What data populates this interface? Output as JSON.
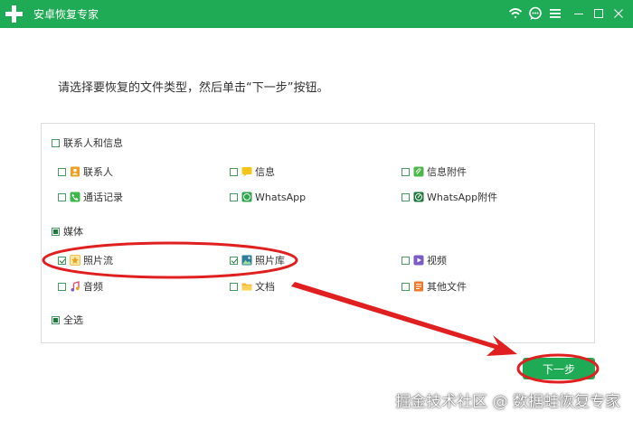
{
  "app": {
    "title": "安卓恢复专家"
  },
  "instruction": "请选择要恢复的文件类型，然后单击“下一步”按钮。",
  "groups": {
    "contacts": {
      "label": "联系人和信息",
      "state": "unchecked",
      "items": [
        {
          "label": "联系人",
          "checked": false,
          "icon": "contact-book-icon"
        },
        {
          "label": "信息",
          "checked": false,
          "icon": "message-icon"
        },
        {
          "label": "信息附件",
          "checked": false,
          "icon": "attachment-icon"
        },
        {
          "label": "通话记录",
          "checked": false,
          "icon": "phone-icon"
        },
        {
          "label": "WhatsApp",
          "checked": false,
          "icon": "whatsapp-icon"
        },
        {
          "label": "WhatsApp附件",
          "checked": false,
          "icon": "whatsapp-attachment-icon"
        }
      ]
    },
    "media": {
      "label": "媒体",
      "state": "partial",
      "items": [
        {
          "label": "照片流",
          "checked": true,
          "icon": "photo-stream-icon"
        },
        {
          "label": "照片库",
          "checked": true,
          "icon": "photo-library-icon"
        },
        {
          "label": "视频",
          "checked": false,
          "icon": "video-icon"
        },
        {
          "label": "音频",
          "checked": false,
          "icon": "music-icon"
        },
        {
          "label": "文档",
          "checked": false,
          "icon": "folder-icon"
        },
        {
          "label": "其他文件",
          "checked": false,
          "icon": "other-files-icon"
        }
      ]
    }
  },
  "select_all": {
    "label": "全选",
    "state": "partial"
  },
  "next_button": {
    "label": "下一步"
  },
  "watermark": "掘金技术社区 @ 数据蛙恢复专家",
  "colors": {
    "brand_green": "#1faa55",
    "annotation_red": "#e02020"
  }
}
